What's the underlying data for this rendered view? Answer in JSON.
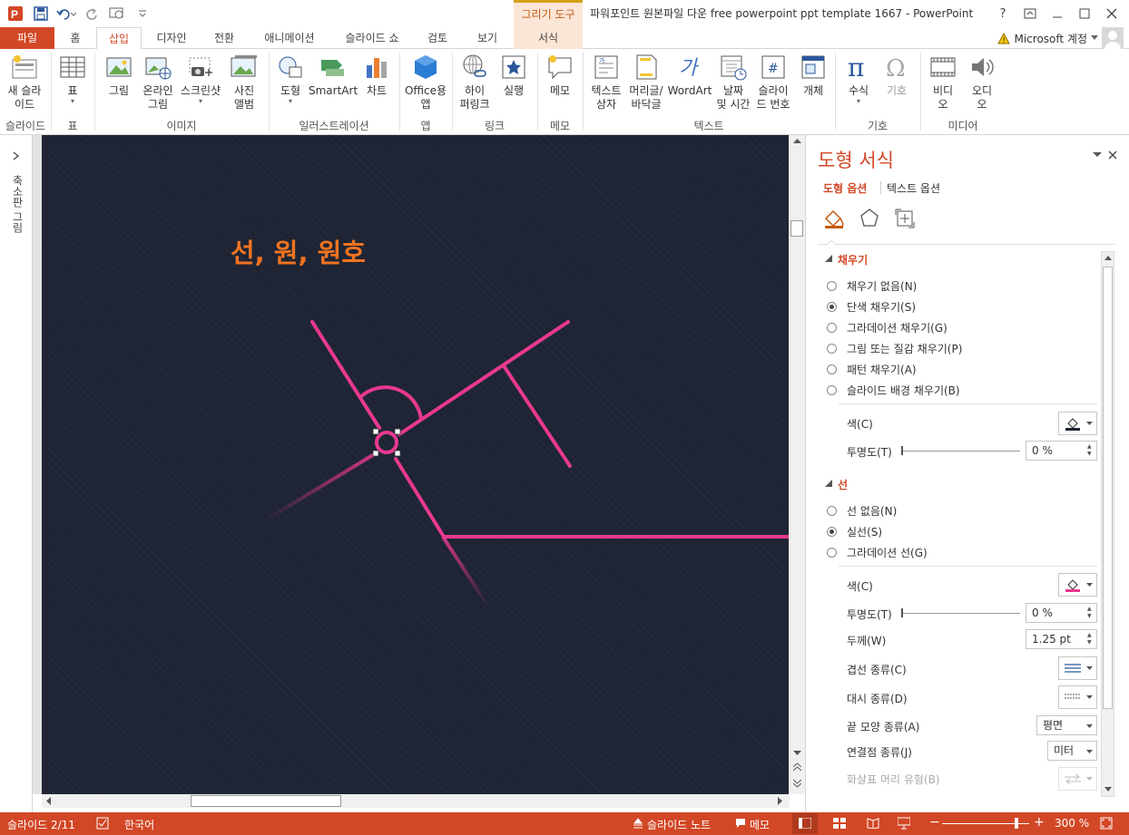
{
  "app": {
    "title": "파워포인트 원본파일 다운 free powerpoint ppt template 1667 - PowerPoint",
    "context_header": "그리기 도구",
    "account": "Microsoft 계정",
    "help": "?"
  },
  "tabs": [
    {
      "label": "파일"
    },
    {
      "label": "홈"
    },
    {
      "label": "삽입"
    },
    {
      "label": "디자인"
    },
    {
      "label": "전환"
    },
    {
      "label": "애니메이션"
    },
    {
      "label": "슬라이드 쇼"
    },
    {
      "label": "검토"
    },
    {
      "label": "보기"
    },
    {
      "label": "서식"
    }
  ],
  "ribbon": {
    "buttons": [
      {
        "label": "새 슬라\n이드",
        "icon": "new-slide-icon"
      },
      {
        "label": "표",
        "icon": "table-icon"
      },
      {
        "label": "그림",
        "icon": "picture-icon"
      },
      {
        "label": "온라인\n그림",
        "icon": "online-picture-icon"
      },
      {
        "label": "스크린샷",
        "icon": "screenshot-icon"
      },
      {
        "label": "사진\n앨범",
        "icon": "photo-album-icon"
      },
      {
        "label": "도형",
        "icon": "shapes-icon"
      },
      {
        "label": "SmartArt",
        "icon": "smartart-icon"
      },
      {
        "label": "차트",
        "icon": "chart-icon"
      },
      {
        "label": "Office용\n앱",
        "icon": "office-apps-icon"
      },
      {
        "label": "하이\n퍼링크",
        "icon": "hyperlink-icon"
      },
      {
        "label": "실행",
        "icon": "action-icon"
      },
      {
        "label": "메모",
        "icon": "comment-icon"
      },
      {
        "label": "텍스트\n상자",
        "icon": "textbox-icon"
      },
      {
        "label": "머리글/\n바닥글",
        "icon": "header-footer-icon"
      },
      {
        "label": "WordArt",
        "icon": "wordart-icon"
      },
      {
        "label": "날짜\n및 시간",
        "icon": "date-time-icon"
      },
      {
        "label": "슬라이\n드 번호",
        "icon": "slide-number-icon"
      },
      {
        "label": "개체",
        "icon": "object-icon"
      },
      {
        "label": "수식",
        "icon": "equation-icon"
      },
      {
        "label": "기호",
        "icon": "symbol-icon"
      },
      {
        "label": "비디\n오",
        "icon": "video-icon"
      },
      {
        "label": "오디\n오",
        "icon": "audio-icon"
      }
    ],
    "groups": [
      "슬라이드",
      "표",
      "이미지",
      "일러스트레이션",
      "앱",
      "링크",
      "메모",
      "텍스트",
      "기호",
      "미디어"
    ]
  },
  "left_pane": {
    "label": "축소판 그림"
  },
  "slide": {
    "title": "선, 원, 원호",
    "background": "#1e2433",
    "accent": "#e8398f",
    "title_color": "#f07320"
  },
  "format_pane": {
    "title": "도형 서식",
    "subtabs": [
      "도형 옵션",
      "텍스트 옵션"
    ],
    "fill": {
      "header": "채우기",
      "options": [
        "채우기 없음(N)",
        "단색 채우기(S)",
        "그라데이션 채우기(G)",
        "그림 또는 질감 채우기(P)",
        "패턴 채우기(A)",
        "슬라이드 배경 채우기(B)"
      ],
      "selected": "단색 채우기(S)",
      "color_label": "색(C)",
      "transparency_label": "투명도(T)",
      "transparency_value": "0 %"
    },
    "line": {
      "header": "선",
      "options": [
        "선 없음(N)",
        "실선(S)",
        "그라데이션 선(G)"
      ],
      "selected": "실선(S)",
      "color_label": "색(C)",
      "transparency_label": "투명도(T)",
      "transparency_value": "0 %",
      "width_label": "두께(W)",
      "width_value": "1.25 pt",
      "compound_label": "겹선 종류(C)",
      "dash_label": "대시 종류(D)",
      "cap_label": "끝 모양 종류(A)",
      "cap_value": "평면",
      "join_label": "연결점 종류(J)",
      "join_value": "미터",
      "arrow_label": "화살표 머리 유형(B)"
    }
  },
  "status": {
    "slide": "슬라이드 2/11",
    "language": "한국어",
    "notes": "슬라이드 노트",
    "comments": "메모",
    "zoom": "300 %"
  }
}
